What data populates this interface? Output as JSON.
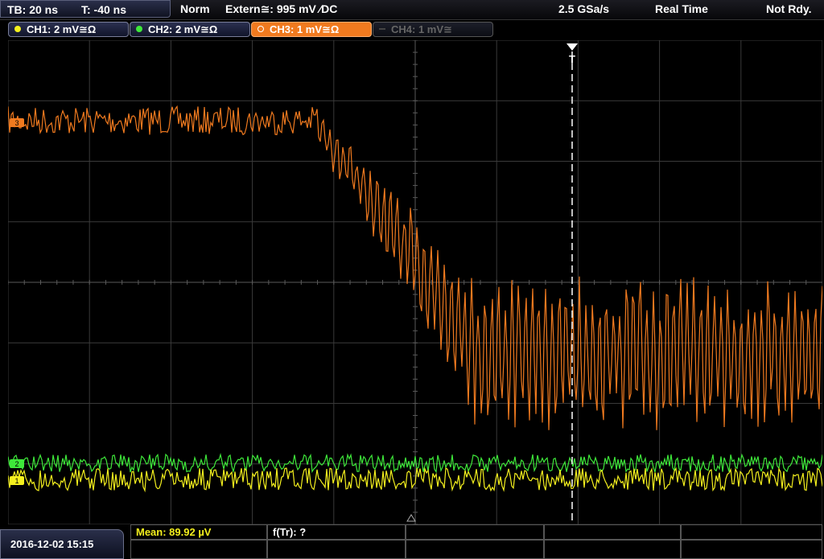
{
  "top": {
    "timebase": "TB: 20 ns",
    "trigger_time": "T: -40 ns",
    "trigger_mode": "Norm",
    "trigger_source": "Extern≅: 995 mV ∕DC",
    "sample_rate": "2.5 GSa/s",
    "acq_mode": "Real Time",
    "status": "Not Rdy."
  },
  "channels": [
    {
      "label": "CH1: 2 mV≅Ω",
      "color": "#f4f01e",
      "state": "on"
    },
    {
      "label": "CH2: 2 mV≅Ω",
      "color": "#3ee83a",
      "state": "on"
    },
    {
      "label": "CH3: 1 mV≅Ω",
      "color": "#f07a1f",
      "state": "selected"
    },
    {
      "label": "CH4: 1 mV≅",
      "color": "#555555",
      "state": "off"
    }
  ],
  "markers": {
    "trigger_marker": "T",
    "ch3_marker": "3",
    "ch2_marker": "2",
    "ch1_marker": "1"
  },
  "bottom": {
    "datetime": "2016-12-02 15:15",
    "mean": "Mean: 89.92 µV",
    "freq": "f(Tr): ?"
  },
  "colors": {
    "ch1": "#f4f01e",
    "ch2": "#3ee83a",
    "ch3": "#f07a1f",
    "grid": "#3a3a3a",
    "measure_text": "#f4f01e"
  }
}
